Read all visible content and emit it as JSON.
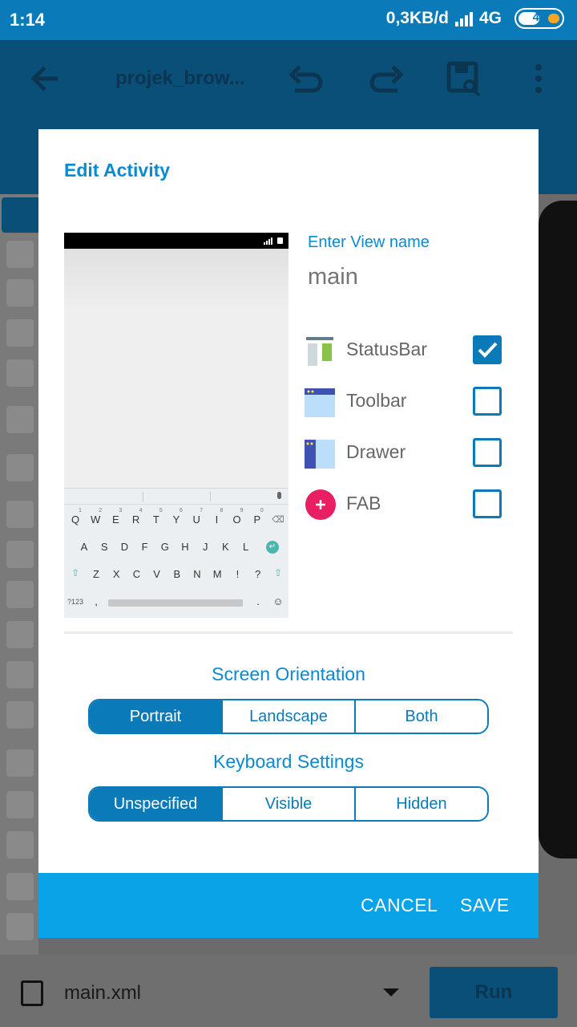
{
  "status_bar": {
    "time": "1:14",
    "net_speed": "0,3KB/d",
    "network": "4G",
    "battery": "43"
  },
  "app_bar": {
    "title": "projek_brow...",
    "icons": [
      "back-arrow-icon",
      "undo-icon",
      "redo-icon",
      "save-icon",
      "more-vert-icon"
    ]
  },
  "bottom_bar": {
    "file_name": "main.xml",
    "run_label": "Run"
  },
  "dialog": {
    "title": "Edit Activity",
    "view_name_label": "Enter View name",
    "view_name_placeholder": "main",
    "options": [
      {
        "label": "StatusBar",
        "checked": true
      },
      {
        "label": "Toolbar",
        "checked": false
      },
      {
        "label": "Drawer",
        "checked": false
      },
      {
        "label": "FAB",
        "checked": false
      }
    ],
    "preview_keyboard": {
      "row1": [
        "Q",
        "W",
        "E",
        "R",
        "T",
        "Y",
        "U",
        "I",
        "O",
        "P"
      ],
      "row1_nums": [
        "1",
        "2",
        "3",
        "4",
        "5",
        "6",
        "7",
        "8",
        "9",
        "0"
      ],
      "row2": [
        "A",
        "S",
        "D",
        "F",
        "G",
        "H",
        "J",
        "K",
        "L"
      ],
      "row3": [
        "Z",
        "X",
        "C",
        "V",
        "B",
        "N",
        "M",
        "!",
        "?"
      ],
      "row4_left": "?123",
      "row4_comma": ",",
      "row4_period": "."
    },
    "screen_orientation": {
      "title": "Screen Orientation",
      "options": [
        "Portrait",
        "Landscape",
        "Both"
      ],
      "selected": "Portrait"
    },
    "keyboard_settings": {
      "title": "Keyboard Settings",
      "options": [
        "Unspecified",
        "Visible",
        "Hidden"
      ],
      "selected": "Unspecified"
    },
    "cancel_label": "CANCEL",
    "save_label": "SAVE"
  },
  "colors": {
    "primary": "#0a7bb8",
    "accent_text": "#0a8ad0",
    "footer": "#0aa3e8",
    "fab": "#e91e63"
  }
}
